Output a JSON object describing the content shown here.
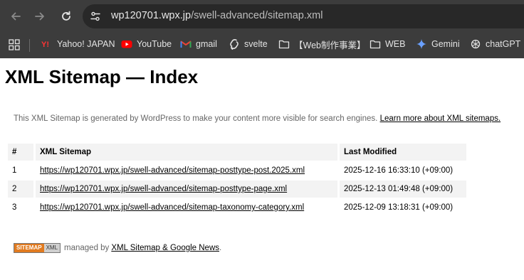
{
  "browser": {
    "url_host": "wp120701.wpx.jp",
    "url_path": "/swell-advanced/sitemap.xml"
  },
  "bookmarks": [
    {
      "label": "Yahoo! JAPAN",
      "icon": "yahoo-icon"
    },
    {
      "label": "YouTube",
      "icon": "youtube-icon"
    },
    {
      "label": "gmail",
      "icon": "gmail-icon"
    },
    {
      "label": "svelte",
      "icon": "svelte-icon"
    },
    {
      "label": "【Web制作事業】",
      "icon": "folder-icon"
    },
    {
      "label": "WEB",
      "icon": "folder-icon"
    },
    {
      "label": "Gemini",
      "icon": "gemini-icon"
    },
    {
      "label": "chatGPT",
      "icon": "chatgpt-icon"
    }
  ],
  "page": {
    "title": "XML Sitemap — Index",
    "description": "This XML Sitemap is generated by WordPress to make your content more visible for search engines.",
    "learn_more": "Learn more about XML sitemaps.",
    "table": {
      "headers": [
        "#",
        "XML Sitemap",
        "Last Modified"
      ],
      "rows": [
        {
          "num": "1",
          "url": "https://wp120701.wpx.jp/swell-advanced/sitemap-posttype-post.2025.xml",
          "modified": "2025-12-16 16:33:10 (+09:00)"
        },
        {
          "num": "2",
          "url": "https://wp120701.wpx.jp/swell-advanced/sitemap-posttype-page.xml",
          "modified": "2025-12-13 01:49:48 (+09:00)"
        },
        {
          "num": "3",
          "url": "https://wp120701.wpx.jp/swell-advanced/sitemap-taxonomy-category.xml",
          "modified": "2025-12-09 13:18:31 (+09:00)"
        }
      ]
    },
    "footer": {
      "badge_left": "SITEMAP",
      "badge_right": "XML",
      "managed_by": "managed by",
      "plugin_link": "XML Sitemap & Google News",
      "period": "."
    }
  },
  "colors": {
    "chrome_bg": "#3c3c3c",
    "omnibox_bg": "#282828",
    "header_cell_bg": "#f3f3f3",
    "badge_orange": "#e17b20"
  }
}
